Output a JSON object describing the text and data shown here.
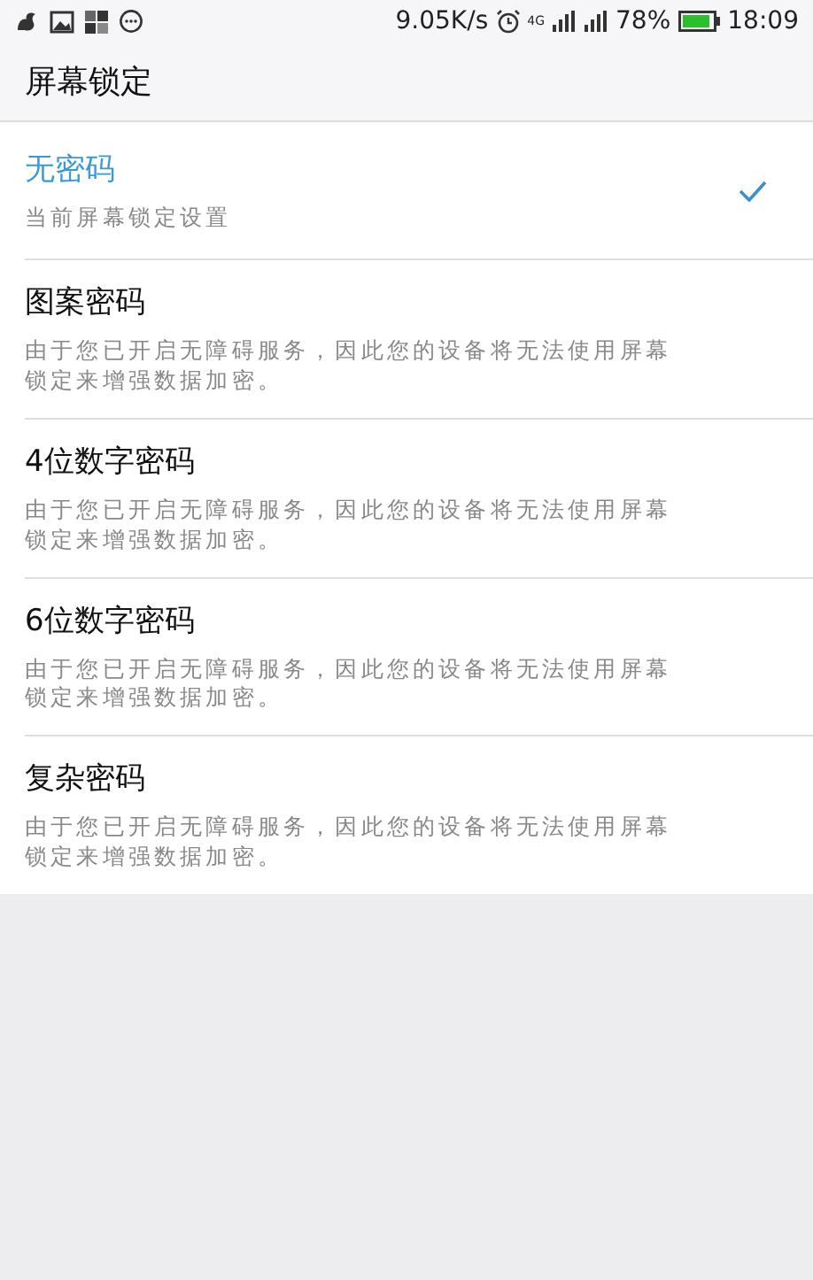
{
  "status_bar": {
    "speed": "9.05K/s",
    "network": "4G",
    "battery": "78%",
    "time": "18:09"
  },
  "title": "屏幕锁定",
  "options": [
    {
      "label": "无密码",
      "description": "当前屏幕锁定设置",
      "selected": true
    },
    {
      "label": "图案密码",
      "description": "由于您已开启无障碍服务，因此您的设备将无法使用屏幕锁定来增强数据加密。",
      "selected": false
    },
    {
      "label": "4位数字密码",
      "description": "由于您已开启无障碍服务，因此您的设备将无法使用屏幕锁定来增强数据加密。",
      "selected": false
    },
    {
      "label": "6位数字密码",
      "description": "由于您已开启无障碍服务，因此您的设备将无法使用屏幕锁定来增强数据加密。",
      "selected": false
    },
    {
      "label": "复杂密码",
      "description": "由于您已开启无障碍服务，因此您的设备将无法使用屏幕锁定来增强数据加密。",
      "selected": false
    }
  ]
}
